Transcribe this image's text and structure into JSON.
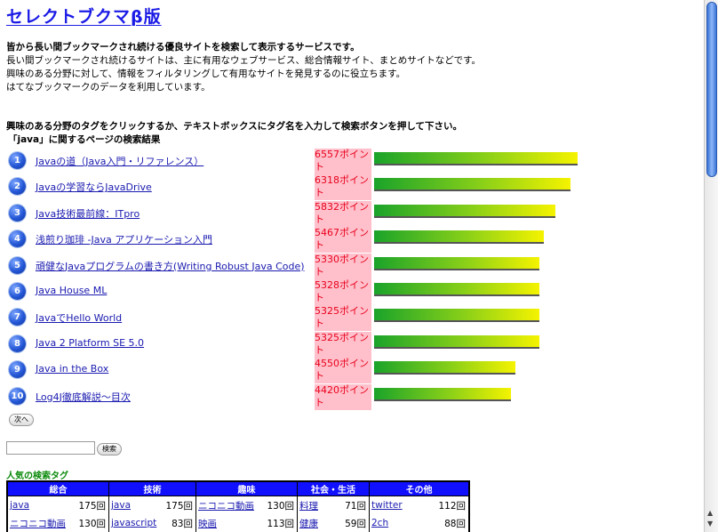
{
  "title": "セレクトブクマβ版",
  "intro": {
    "bold_line": "皆から長い間ブックマークされ続ける優良サイトを検索して表示するサービスです。",
    "line2": "長い間ブックマークされ続けるサイトは、主に有用なウェブサービス、総合情報サイト、まとめサイトなどです。",
    "line3": "興味のある分野に対して、情報をフィルタリングして有用なサイトを発見するのに役立ちます。",
    "line4": "はてなブックマークのデータを利用しています。"
  },
  "instruction": "興味のある分野のタグをクリックするか、テキストボックスにタグ名を入力して検索ボタンを押して下さい。",
  "results_heading": "「java」に関するページの検索結果",
  "results": [
    {
      "rank": "1",
      "title": "Javaの道（Java入門・リファレンス）",
      "points": "6557ポイント",
      "value": 6557
    },
    {
      "rank": "2",
      "title": "Javaの学習ならJavaDrive",
      "points": "6318ポイント",
      "value": 6318
    },
    {
      "rank": "3",
      "title": "Java技術最前線：ITpro",
      "points": "5832ポイント",
      "value": 5832
    },
    {
      "rank": "4",
      "title": "浅煎り珈琲 -Java アプリケーション入門",
      "points": "5467ポイント",
      "value": 5467
    },
    {
      "rank": "5",
      "title": "頑健なJavaプログラムの書き方(Writing Robust Java Code)",
      "points": "5330ポイント",
      "value": 5330
    },
    {
      "rank": "6",
      "title": "Java House ML",
      "points": "5328ポイント",
      "value": 5328
    },
    {
      "rank": "7",
      "title": "JavaでHello World",
      "points": "5325ポイント",
      "value": 5325
    },
    {
      "rank": "8",
      "title": "Java 2 Platform SE 5.0",
      "points": "5325ポイント",
      "value": 5325
    },
    {
      "rank": "9",
      "title": "Java in the Box",
      "points": "4550ポイント",
      "value": 4550
    },
    {
      "rank": "10",
      "title": "Log4J徹底解説～目次",
      "points": "4420ポイント",
      "value": 4420
    }
  ],
  "next_button": "次へ",
  "search": {
    "value": "",
    "button": "検索"
  },
  "popular": {
    "heading": "人気の検索タグ",
    "columns": [
      "総合",
      "技術",
      "趣味",
      "社会・生活",
      "その他"
    ],
    "rows": [
      [
        [
          "java",
          "175回"
        ],
        [
          "java",
          "175回"
        ],
        [
          "ニコニコ動画",
          "130回"
        ],
        [
          "料理",
          "71回"
        ],
        [
          "twitter",
          "112回"
        ]
      ],
      [
        [
          "ニコニコ動画",
          "130回"
        ],
        [
          "javascript",
          "83回"
        ],
        [
          "映画",
          "113回"
        ],
        [
          "健康",
          "59回"
        ],
        [
          "2ch",
          "88回"
        ]
      ]
    ]
  }
}
